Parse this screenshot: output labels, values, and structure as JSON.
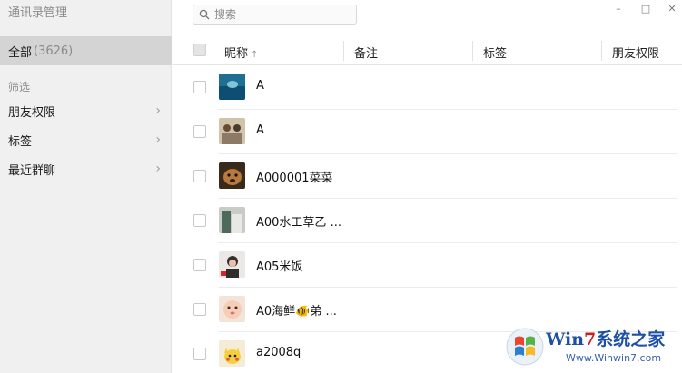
{
  "app": {
    "title": "通讯录管理"
  },
  "sidebar": {
    "all_label": "全部",
    "all_count": "(3626)",
    "filter_heading": "筛选",
    "filters": [
      {
        "label": "朋友权限"
      },
      {
        "label": "标签"
      },
      {
        "label": "最近群聊"
      }
    ]
  },
  "search": {
    "placeholder": "搜索",
    "value": ""
  },
  "window_controls": {
    "minimize": "–",
    "maximize": "□",
    "close": "✕"
  },
  "table": {
    "columns": [
      "昵称",
      "备注",
      "标签",
      "朋友权限"
    ],
    "sort_indicator": "↑",
    "rows": [
      {
        "name": "A",
        "avatar": "underwater-photo"
      },
      {
        "name": "A",
        "avatar": "people-photo"
      },
      {
        "name": "A000001菜菜",
        "avatar": "dog-photo"
      },
      {
        "name": "A00水工草乙 ...",
        "avatar": "building-photo"
      },
      {
        "name": "A05米饭",
        "avatar": "person-photo"
      },
      {
        "name": "A0海鲜🐠弟 ...",
        "avatar": "baby-photo"
      },
      {
        "name": "a2008q",
        "avatar": "cartoon-photo"
      }
    ]
  },
  "watermark": {
    "title_a": "Win",
    "title_b": "7",
    "title_c": "系统之家",
    "subtitle": "Www.Winwin7.com"
  }
}
